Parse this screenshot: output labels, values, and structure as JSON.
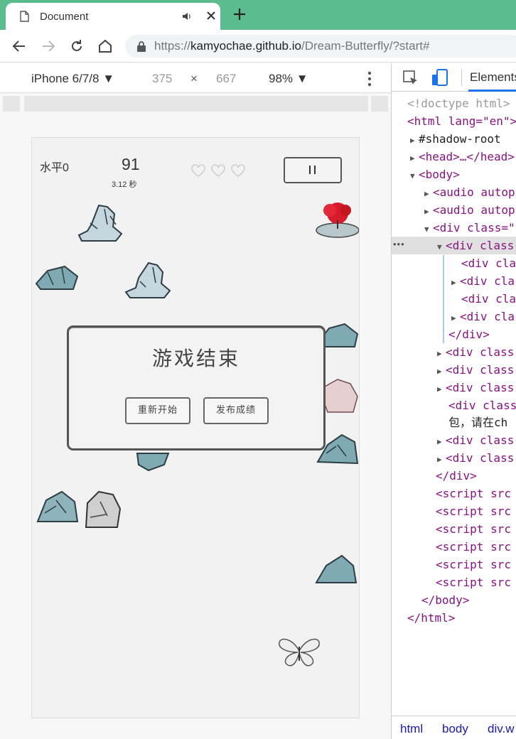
{
  "browser": {
    "tab_title": "Document",
    "url_prefix": "https://",
    "url_host": "kamyochae.github.io",
    "url_path": "/Dream-Butterfly/?start#"
  },
  "device_toolbar": {
    "device": "iPhone 6/7/8",
    "width": "375",
    "times": "×",
    "height": "667",
    "zoom": "98%"
  },
  "game": {
    "level": "水平0",
    "score": "91",
    "time": "3.12 秒",
    "hearts": 3,
    "modal": {
      "title": "游戏结束",
      "restart": "重新开始",
      "publish": "发布成绩"
    }
  },
  "devtools": {
    "tab": "Elements",
    "tree": [
      "<!doctype html>",
      "<html lang=\"en\">",
      "#shadow-root",
      "<head>…</head>",
      "<body>",
      "<audio autop",
      "<audio autop",
      "<div class=\"",
      "<div class",
      "<div cla",
      "<div cla",
      "<div cla",
      "<div cla",
      "</div>",
      "<div class",
      "<div class",
      "<div class",
      "<div class",
      "包，请在ch",
      "<div class",
      "<div class",
      "</div>",
      "<script src",
      "<script src",
      "<script src",
      "<script src",
      "<script src",
      "<script src",
      "</body>",
      "</html>"
    ],
    "breadcrumb": [
      "html",
      "body",
      "div.w"
    ],
    "ellipsis": "•••"
  }
}
